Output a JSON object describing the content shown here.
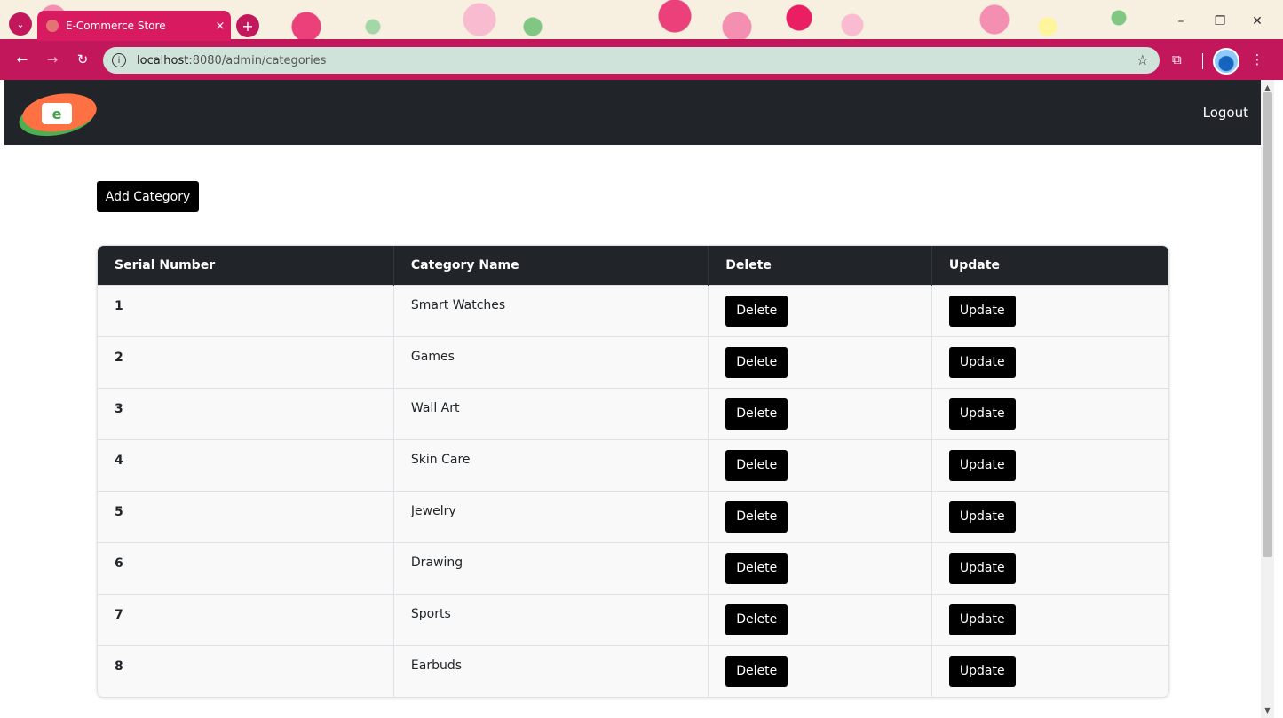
{
  "browser": {
    "tab_title": "E-Commerce Store",
    "tab_close": "×",
    "url_host": "localhost",
    "url_path": ":8080/admin/categories"
  },
  "navbar": {
    "logout_label": "Logout"
  },
  "page": {
    "add_button_label": "Add Category"
  },
  "table": {
    "columns": [
      "Serial Number",
      "Category Name",
      "Delete",
      "Update"
    ],
    "rows": [
      {
        "serial": "1",
        "name": "Smart Watches",
        "delete_label": "Delete",
        "update_label": "Update"
      },
      {
        "serial": "2",
        "name": "Games",
        "delete_label": "Delete",
        "update_label": "Update"
      },
      {
        "serial": "3",
        "name": "Wall Art",
        "delete_label": "Delete",
        "update_label": "Update"
      },
      {
        "serial": "4",
        "name": "Skin Care",
        "delete_label": "Delete",
        "update_label": "Update"
      },
      {
        "serial": "5",
        "name": "Jewelry",
        "delete_label": "Delete",
        "update_label": "Update"
      },
      {
        "serial": "6",
        "name": "Drawing",
        "delete_label": "Delete",
        "update_label": "Update"
      },
      {
        "serial": "7",
        "name": "Sports",
        "delete_label": "Delete",
        "update_label": "Update"
      },
      {
        "serial": "8",
        "name": "Earbuds",
        "delete_label": "Delete",
        "update_label": "Update"
      }
    ]
  },
  "icons": {
    "back": "back-arrow-icon",
    "forward": "forward-arrow-icon",
    "reload": "reload-icon",
    "info": "site-info-icon",
    "star": "bookmark-star-icon",
    "extensions": "extensions-icon",
    "menu": "kebab-menu-icon"
  },
  "colors": {
    "chrome_accent": "#c2185b",
    "navbar_bg": "#212529",
    "button_bg": "#000000",
    "row_bg": "#f9f9f9"
  }
}
